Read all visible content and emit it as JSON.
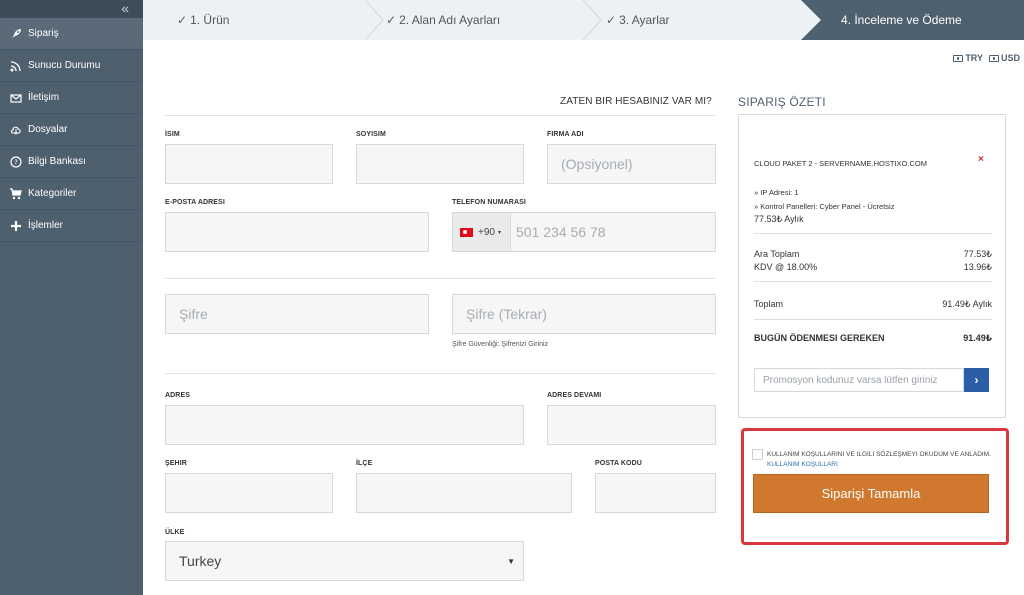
{
  "sidebar": {
    "collapse_icon": "double-chevron-left-icon",
    "collapse_glyph": "«",
    "items": [
      {
        "label": "Sipariş",
        "icon": "rocket-icon",
        "active": true
      },
      {
        "label": "Sunucu Durumu",
        "icon": "signal-icon",
        "active": false
      },
      {
        "label": "İletişim",
        "icon": "envelope-icon",
        "active": false
      },
      {
        "label": "Dosyalar",
        "icon": "cloud-download-icon",
        "active": false
      },
      {
        "label": "Bilgi Bankası",
        "icon": "question-circle-icon",
        "active": false
      },
      {
        "label": "Kategoriler",
        "icon": "cart-icon",
        "active": false
      },
      {
        "label": "İşlemler",
        "icon": "plus-icon",
        "active": false
      }
    ]
  },
  "steps": [
    {
      "label": "1. Ürün",
      "done": true
    },
    {
      "label": "2. Alan Adı Ayarları",
      "done": true
    },
    {
      "label": "3. Ayarlar",
      "done": true
    },
    {
      "label": "4. İnceleme ve Ödeme",
      "done": false,
      "active": true
    }
  ],
  "step_check_glyph": "✓",
  "currency": {
    "options": [
      "TRY",
      "USD"
    ]
  },
  "form": {
    "have_account_link": "ZATEN BIR HESABINIZ VAR MI?",
    "labels": {
      "first_name": "İSIM",
      "last_name": "SOYISIM",
      "company": "FIRMA ADI",
      "email": "E-POSTA ADRESI",
      "phone": "TELEFON NUMARASI",
      "address": "ADRES",
      "address2": "ADRES DEVAMI",
      "city": "ŞEHIR",
      "district": "İLÇE",
      "postcode": "POSTA KODU",
      "country": "ÜLKE"
    },
    "placeholders": {
      "company": "(Opsiyonel)",
      "password": "Şifre",
      "password_repeat": "Şifre (Tekrar)"
    },
    "phone": {
      "dial_code": "+90",
      "placeholder": "501 234 56 78",
      "flag": "turkey-flag-icon",
      "caret": "▾"
    },
    "password_strength": "Şifre Güvenliği: Şifrenizi Giriniz",
    "country_value": "Turkey",
    "select_caret": "▼"
  },
  "summary": {
    "title": "SIPARIŞ ÖZETI",
    "product_name": "CLOUD PAKET 2 - SERVERNAME.HOSTIXO.COM",
    "remove_glyph": "×",
    "options": [
      "» IP Adresi: 1",
      "» Kontrol Panelleri: Cyber Panel - Ücretsiz"
    ],
    "recurring": "77.53₺ Aylık",
    "subtotal_label": "Ara Toplam",
    "subtotal_value": "77.53₺",
    "tax_label": "KDV @ 18.00%",
    "tax_value": "13.96₺",
    "total_label": "Toplam",
    "total_value": "91.49₺ Aylık",
    "due_today_label": "BUGÜN ÖDENMESI GEREKEN",
    "due_today_value": "91.49₺",
    "promo_placeholder": "Promosyon kodunuz varsa lütfen giriniz",
    "promo_button_glyph": "›"
  },
  "terms": {
    "text": "KULLANIM KOŞULLARINI VE ILGILI SÖZLEŞMEYI OKUDUM VE ANLADIM.",
    "link": "KULLANIM KOŞULLARI"
  },
  "complete_button": "Siparişi Tamamla",
  "colors": {
    "sidebar_bg": "#4e5f6e",
    "active_step_bg": "#4e5f6e",
    "complete_button": "#d1782f",
    "promo_button": "#2b5ea7",
    "highlight_border": "#d9363e"
  }
}
